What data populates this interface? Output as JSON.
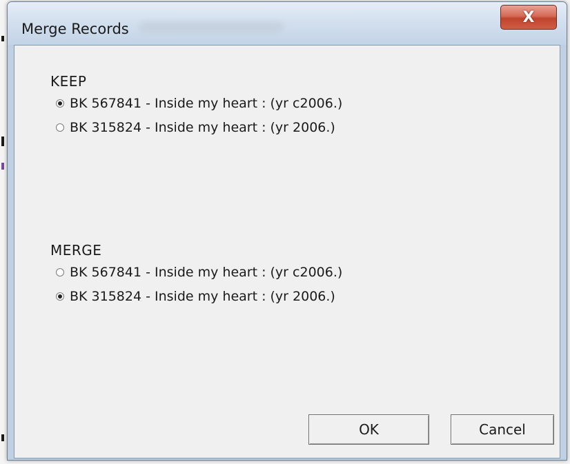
{
  "window": {
    "title": "Merge Records",
    "close_glyph": "X"
  },
  "keep": {
    "label": "KEEP",
    "options": [
      {
        "label": "BK 567841 - Inside my heart : (yr c2006.)",
        "checked": true
      },
      {
        "label": "BK 315824 - Inside my heart : (yr 2006.)",
        "checked": false
      }
    ]
  },
  "merge": {
    "label": "MERGE",
    "options": [
      {
        "label": "BK 567841 - Inside my heart : (yr c2006.)",
        "checked": false
      },
      {
        "label": "BK 315824 - Inside my heart : (yr 2006.)",
        "checked": true
      }
    ]
  },
  "buttons": {
    "ok": "OK",
    "cancel": "Cancel"
  }
}
